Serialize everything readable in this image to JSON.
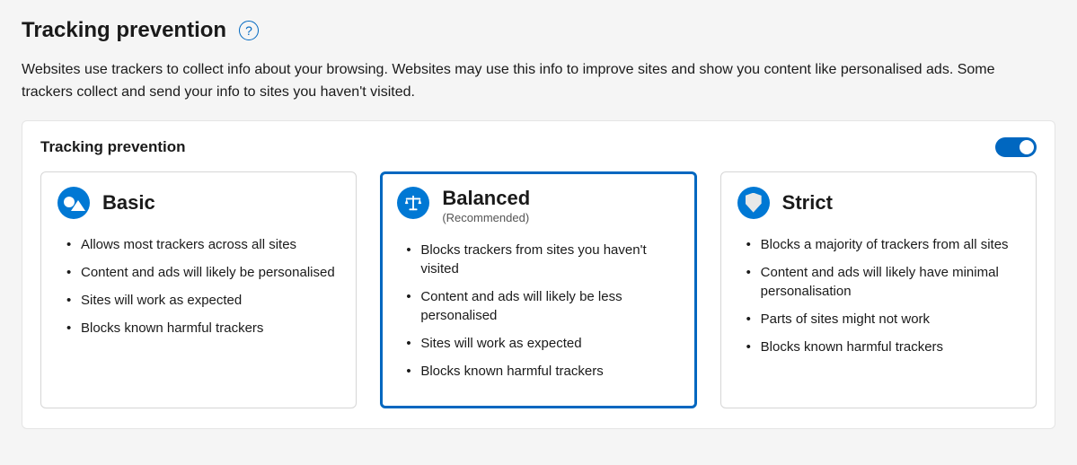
{
  "header": {
    "title": "Tracking prevention",
    "help_glyph": "?"
  },
  "description": "Websites use trackers to collect info about your browsing. Websites may use this info to improve sites and show you content like personalised ads. Some trackers collect and send your info to sites you haven't visited.",
  "panel": {
    "title": "Tracking prevention",
    "toggle_on": true
  },
  "options": {
    "basic": {
      "title": "Basic",
      "subtitle": "",
      "bullets": [
        "Allows most trackers across all sites",
        "Content and ads will likely be personalised",
        "Sites will work as expected",
        "Blocks known harmful trackers"
      ]
    },
    "balanced": {
      "title": "Balanced",
      "subtitle": "(Recommended)",
      "bullets": [
        "Blocks trackers from sites you haven't visited",
        "Content and ads will likely be less personalised",
        "Sites will work as expected",
        "Blocks known harmful trackers"
      ]
    },
    "strict": {
      "title": "Strict",
      "subtitle": "",
      "bullets": [
        "Blocks a majority of trackers from all sites",
        "Content and ads will likely have minimal personalisation",
        "Parts of sites might not work",
        "Blocks known harmful trackers"
      ]
    }
  }
}
